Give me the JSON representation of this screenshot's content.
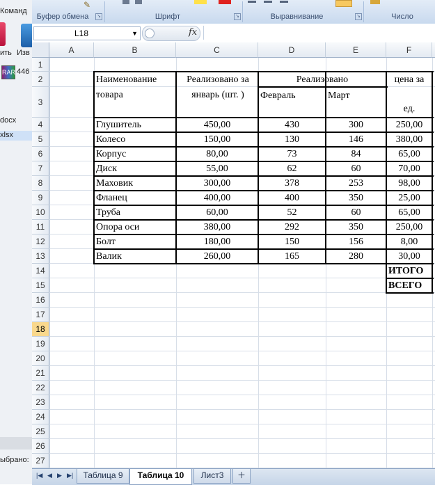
{
  "left_panel": {
    "top_text": "Команд",
    "btn1_label": "ить",
    "btn2_label": "Изв",
    "rar_text": "446",
    "file1": "docx",
    "file2": "xlsx",
    "bottom_text": "ыбрано:"
  },
  "ribbon": {
    "groups": [
      "Буфер обмена",
      "Шрифт",
      "Выравнивание",
      "Число"
    ]
  },
  "formula_bar": {
    "name_box_value": "L18",
    "fx_label": "fx",
    "formula_value": ""
  },
  "sheet": {
    "columns": [
      "A",
      "B",
      "C",
      "D",
      "E",
      "F"
    ],
    "rows": [
      "1",
      "2",
      "3",
      "4",
      "5",
      "6",
      "7",
      "8",
      "9",
      "10",
      "11",
      "12",
      "13",
      "14",
      "15",
      "16",
      "17",
      "18",
      "19",
      "20",
      "21",
      "22",
      "23",
      "24",
      "25",
      "26",
      "27"
    ],
    "active_row": "18",
    "header": {
      "b": [
        "Наименование",
        "товара"
      ],
      "c": [
        "Реализовано за",
        "январь (шт. )"
      ],
      "de": "Реализовано",
      "d": "Февраль",
      "e": "Март",
      "f_top": "цена за",
      "f_bottom": "ед."
    },
    "data": [
      {
        "name": "Глушитель",
        "jan": "450,00",
        "feb": "430",
        "mar": "300",
        "price": "250,00"
      },
      {
        "name": "Колесо",
        "jan": "150,00",
        "feb": "130",
        "mar": "146",
        "price": "380,00"
      },
      {
        "name": "Корпус",
        "jan": "80,00",
        "feb": "73",
        "mar": "84",
        "price": "65,00"
      },
      {
        "name": "Диск",
        "jan": "55,00",
        "feb": "62",
        "mar": "60",
        "price": "70,00"
      },
      {
        "name": "Маховик",
        "jan": "300,00",
        "feb": "378",
        "mar": "253",
        "price": "98,00"
      },
      {
        "name": "Фланец",
        "jan": "400,00",
        "feb": "400",
        "mar": "350",
        "price": "25,00"
      },
      {
        "name": "Труба",
        "jan": "60,00",
        "feb": "52",
        "mar": "60",
        "price": "65,00"
      },
      {
        "name": "Опора оси",
        "jan": "380,00",
        "feb": "292",
        "mar": "350",
        "price": "250,00"
      },
      {
        "name": "Болт",
        "jan": "180,00",
        "feb": "150",
        "mar": "156",
        "price": "8,00"
      },
      {
        "name": "Валик",
        "jan": "260,00",
        "feb": "165",
        "mar": "280",
        "price": "30,00"
      }
    ],
    "total_label": "ИТОГО",
    "grand_label": "ВСЕГО"
  },
  "tabs": {
    "items": [
      "Таблица 9",
      "Таблица 10",
      "Лист3"
    ],
    "active": "Таблица 10"
  }
}
